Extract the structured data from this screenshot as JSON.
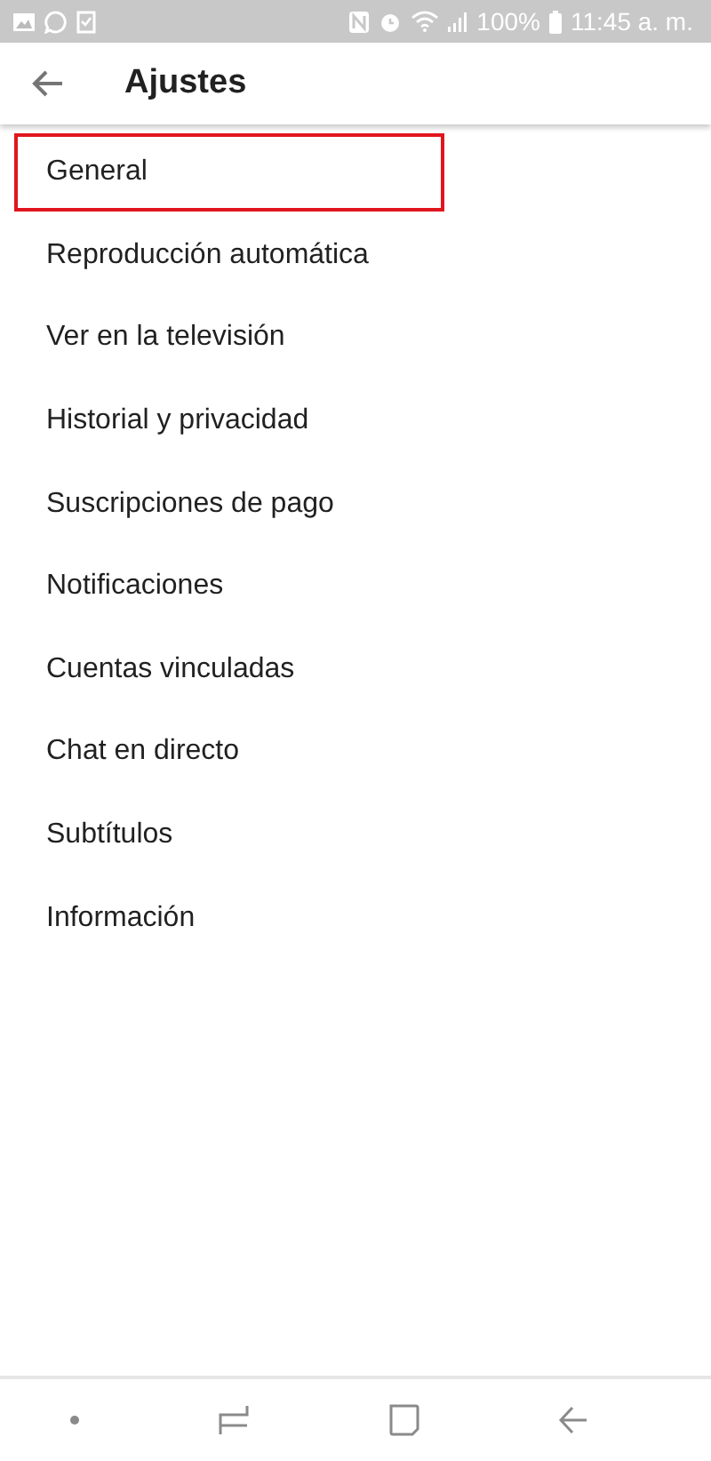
{
  "status_bar": {
    "battery": "100%",
    "time": "11:45 a. m."
  },
  "header": {
    "title": "Ajustes"
  },
  "items": [
    {
      "label": "General",
      "highlighted": true
    },
    {
      "label": "Reproducción automática",
      "highlighted": false
    },
    {
      "label": "Ver en la televisión",
      "highlighted": false
    },
    {
      "label": "Historial y privacidad",
      "highlighted": false
    },
    {
      "label": "Suscripciones de pago",
      "highlighted": false
    },
    {
      "label": "Notificaciones",
      "highlighted": false
    },
    {
      "label": "Cuentas vinculadas",
      "highlighted": false
    },
    {
      "label": "Chat en directo",
      "highlighted": false
    },
    {
      "label": "Subtítulos",
      "highlighted": false
    },
    {
      "label": "Información",
      "highlighted": false
    }
  ]
}
